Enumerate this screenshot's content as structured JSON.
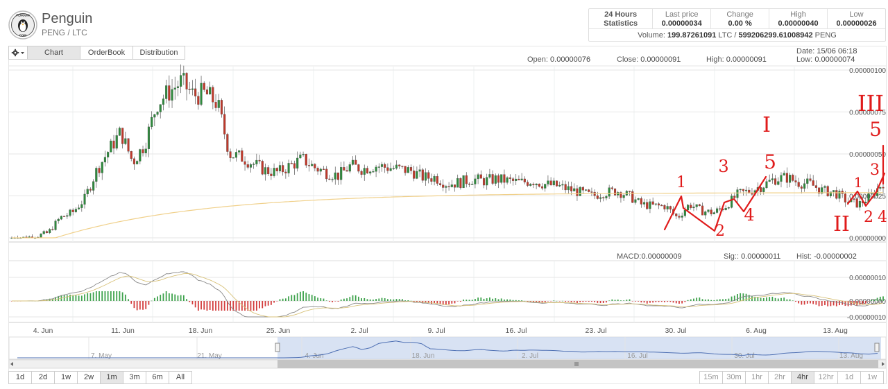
{
  "header": {
    "coin_name": "Penguin",
    "pair": "PENG / LTC",
    "logo_text_top": "PENGUIN",
    "logo_text_bottom": "COIN"
  },
  "stats": {
    "title_line1": "24 Hours",
    "title_line2": "Statistics",
    "last_price_label": "Last price",
    "last_price": "0.00000034",
    "change_label": "Change",
    "change": "0.00 %",
    "high_label": "High",
    "high": "0.00000040",
    "low_label": "Low",
    "low": "0.00000026",
    "volume_label": "Volume:",
    "volume_ltc": "199.87261091",
    "volume_ltc_unit": "LTC /",
    "volume_peng": "599206299.61008942",
    "volume_peng_unit": "PENG"
  },
  "tabs": {
    "settings_icon": "gear-icon",
    "chart": "Chart",
    "orderbook": "OrderBook",
    "distribution": "Distribution"
  },
  "ohlc": {
    "open_label": "Open:",
    "open": "0.00000076",
    "close_label": "Close:",
    "close": "0.00000091",
    "high_label": "High:",
    "high": "0.00000091",
    "date_label": "Date:",
    "date": "15/06 06:18",
    "low_label": "Low:",
    "low": "0.00000074"
  },
  "macd": {
    "macd_label": "MACD:",
    "macd": "0.00000009",
    "sig_label": "Sig::",
    "sig": "0.00000011",
    "hist_label": "Hist:",
    "hist": "-0.00000002"
  },
  "chart_data": {
    "type": "candlestick",
    "price_axis": [
      "0.00000100",
      "0.00000075",
      "0.00000050",
      "0.00000025",
      "0.00000000"
    ],
    "macd_axis": [
      "0.00000010",
      "0.00000000",
      "-0.00000010"
    ],
    "x_ticks": [
      "4. Jun",
      "11. Jun",
      "18. Jun",
      "25. Jun",
      "2. Jul",
      "9. Jul",
      "16. Jul",
      "23. Jul",
      "30. Jul",
      "6. Aug",
      "13. Aug"
    ],
    "navigator_ticks": [
      "7. May",
      "21. May",
      "4. Jun",
      "18. Jun",
      "2. Jul",
      "16. Jul",
      "30. Jul",
      "13. Aug"
    ],
    "series": [
      {
        "values": [
          0.0,
          0.0,
          0.01,
          0.03,
          0.12,
          0.15,
          0.23,
          0.4,
          0.52,
          0.63,
          0.45,
          0.56,
          0.8,
          0.87,
          0.93,
          0.85,
          0.86,
          0.8,
          0.5,
          0.48,
          0.44,
          0.4,
          0.39,
          0.43,
          0.47,
          0.42,
          0.39,
          0.37,
          0.43,
          0.41,
          0.43,
          0.42,
          0.41,
          0.4,
          0.36,
          0.36,
          0.32,
          0.33,
          0.35,
          0.34,
          0.35,
          0.34,
          0.33,
          0.34,
          0.32,
          0.31,
          0.29,
          0.27,
          0.25,
          0.27,
          0.28,
          0.25,
          0.2,
          0.19,
          0.19,
          0.12,
          0.2,
          0.16,
          0.15,
          0.19,
          0.26,
          0.28,
          0.31,
          0.35,
          0.36,
          0.33,
          0.32,
          0.28,
          0.27,
          0.22,
          0.2,
          0.25,
          0.33
        ]
      }
    ],
    "annotations": [
      "1",
      "2",
      "3",
      "4",
      "I",
      "5",
      "II",
      "1",
      "2",
      "3",
      "4",
      "5",
      "III"
    ]
  },
  "periods": {
    "left": [
      "1d",
      "2d",
      "1w",
      "2w",
      "1m",
      "3m",
      "6m",
      "All"
    ],
    "left_active": "1m",
    "right": [
      "15m",
      "30m",
      "1hr",
      "2hr",
      "4hr",
      "12hr",
      "1d",
      "1w"
    ],
    "right_active": "4hr"
  }
}
